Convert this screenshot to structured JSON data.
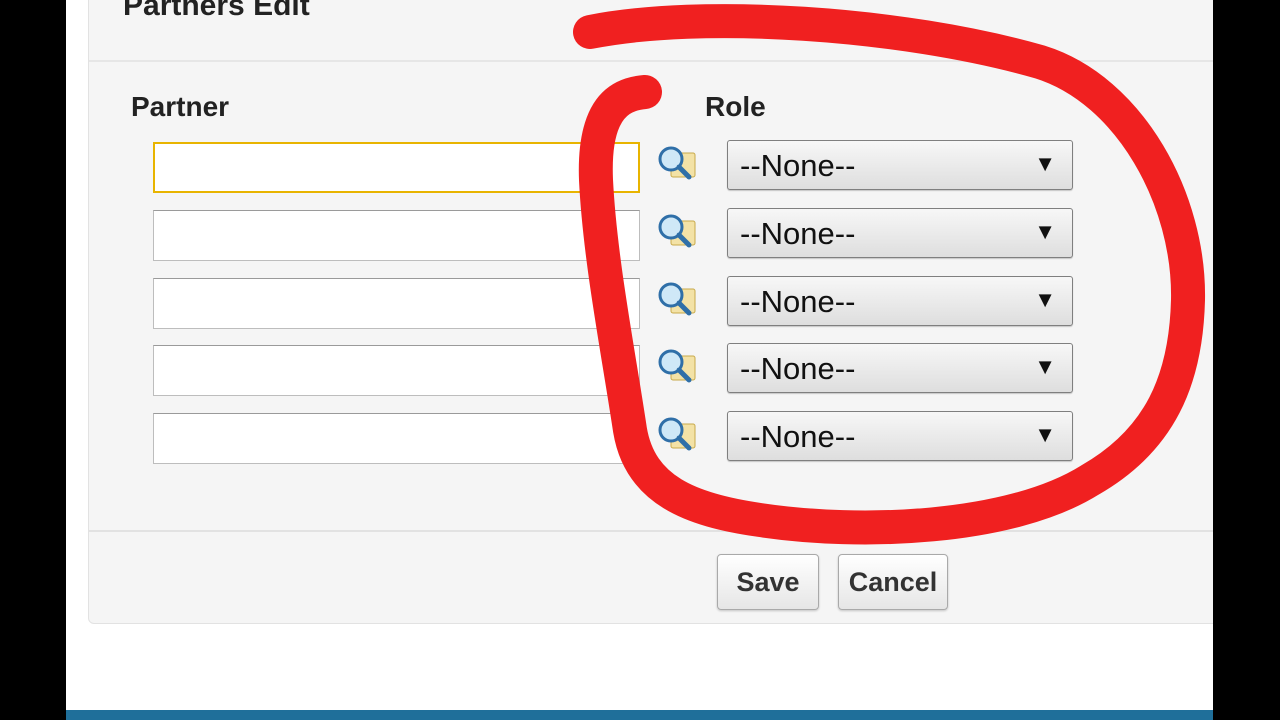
{
  "panel": {
    "title": "Partners Edit"
  },
  "columns": {
    "partner_label": "Partner",
    "role_label": "Role"
  },
  "rows": [
    {
      "partner_value": "",
      "role_value": "--None--"
    },
    {
      "partner_value": "",
      "role_value": "--None--"
    },
    {
      "partner_value": "",
      "role_value": "--None--"
    },
    {
      "partner_value": "",
      "role_value": "--None--"
    },
    {
      "partner_value": "",
      "role_value": "--None--"
    }
  ],
  "icons": {
    "lookup": "magnifier-lookup-icon",
    "dropdown": "triangle-down-icon"
  },
  "arrow_glyph": "▼",
  "buttons": {
    "save_label": "Save",
    "cancel_label": "Cancel"
  },
  "colors": {
    "annotation_red": "#f02020",
    "focus_border": "#e8b400",
    "bottom_bar": "#1f6f9a"
  }
}
